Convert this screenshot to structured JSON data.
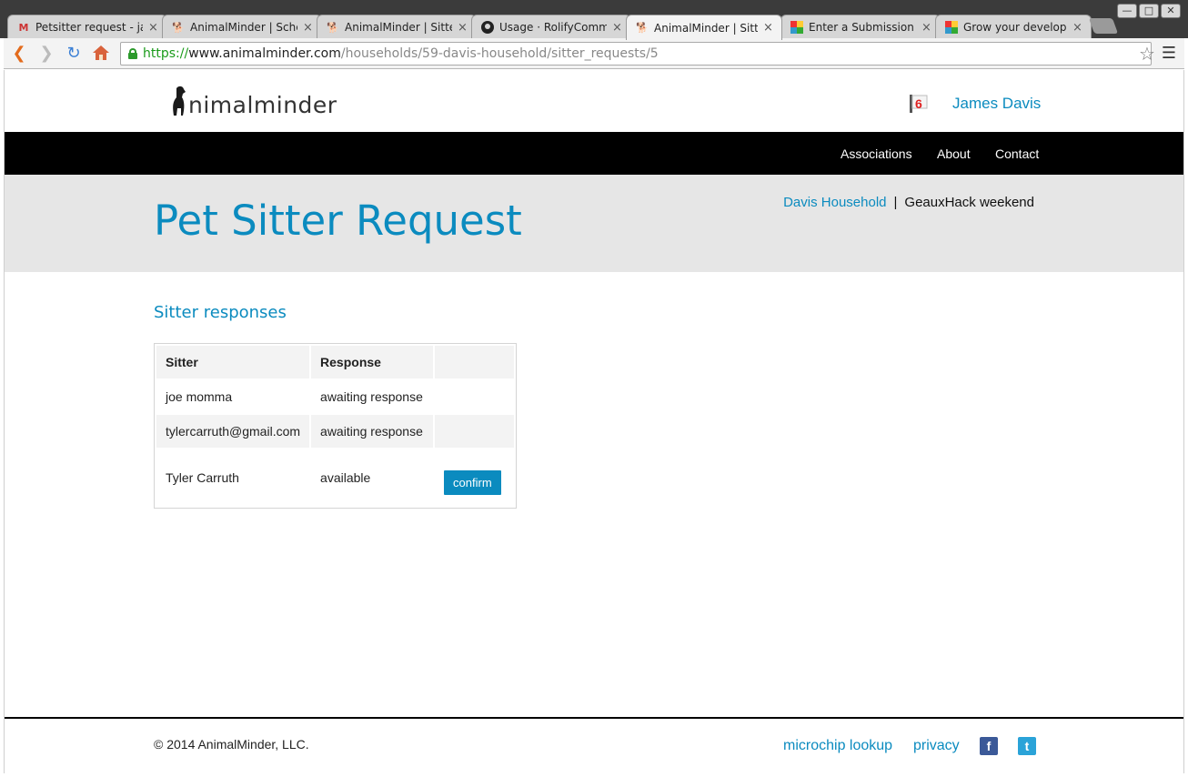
{
  "browser": {
    "tabs": [
      {
        "title": "Petsitter request - jar",
        "icon": "gmail-icon",
        "active": false
      },
      {
        "title": "AnimalMinder | Schec",
        "icon": "animalminder-favicon",
        "active": false
      },
      {
        "title": "AnimalMinder | Sitter",
        "icon": "animalminder-favicon",
        "active": false
      },
      {
        "title": "Usage · RolifyCommu",
        "icon": "github-icon",
        "active": false
      },
      {
        "title": "AnimalMinder | Sitter",
        "icon": "animalminder-favicon",
        "active": true
      },
      {
        "title": "Enter a Submission | C",
        "icon": "devpost-icon",
        "active": false
      },
      {
        "title": "Grow your developer",
        "icon": "devpost-icon",
        "active": false
      }
    ],
    "url": {
      "scheme": "https://",
      "host": "www.animalminder.com",
      "path": "/households/59-davis-household/sitter_requests/5"
    },
    "close_glyph": "×"
  },
  "site": {
    "logo_text": "nimalminder",
    "notification_count": "6",
    "user_name": "James Davis",
    "nav": {
      "associations": "Associations",
      "about": "About",
      "contact": "Contact"
    }
  },
  "banner": {
    "title": "Pet Sitter Request",
    "breadcrumb": {
      "household": "Davis Household",
      "separator": "|",
      "event": "GeauxHack weekend"
    }
  },
  "responses": {
    "section_title": "Sitter responses",
    "headers": {
      "sitter": "Sitter",
      "response": "Response",
      "action": ""
    },
    "rows": [
      {
        "sitter": "joe momma",
        "response": "awaiting response",
        "action": ""
      },
      {
        "sitter": "tylercarruth@gmail.com",
        "response": "awaiting response",
        "action": ""
      },
      {
        "sitter": "Tyler Carruth",
        "response": "available",
        "action": "confirm"
      }
    ]
  },
  "footer": {
    "copyright": "© 2014 AnimalMinder, LLC.",
    "microchip_lookup": "microchip lookup",
    "privacy": "privacy",
    "facebook_glyph": "f",
    "twitter_glyph": "t"
  },
  "colors": {
    "brand_blue": "#0b8bbf",
    "navbar_bg": "#000000",
    "banner_bg": "#e6e6e6",
    "facebook": "#3b5998",
    "twitter": "#2aa3d8"
  }
}
